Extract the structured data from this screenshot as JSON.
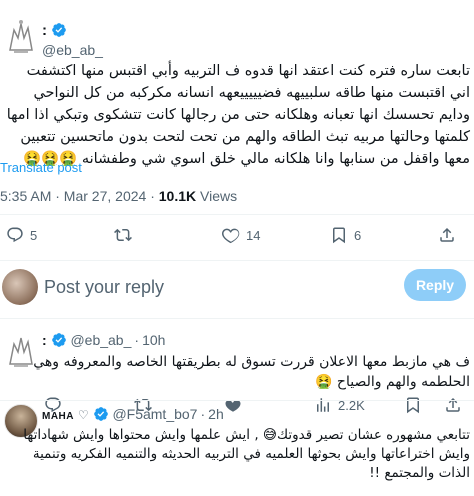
{
  "tweet": {
    "display_name_mark": ":",
    "handle": "@eb_ab_",
    "text": "تابعت ساره فتره كنت اعتقد انها قدوه ف التربيه وأبي اقتبس منها اكتشفت اني اقتبست منها طاقه سلبييهه فضيييييعهه انسانه مكركبه من كل النواحي ودايم تحسسك انها تعبانه وهلكانه حتى من رجالها كانت تتشكوى وتبكي اذا امها كلمتها وحالتها مربيه تبث الطاقه والهم من تحت لتحت بدون ماتحسين تتعبين معها واقفل من سنابها وانا هلكانه مالي خلق اسوي شي وطفشانه 🤮🤮🤮",
    "translate_label": "Translate post",
    "time": "5:35 AM · Mar 27, 2024 · ",
    "views_count": "10.1K",
    "views_label": " Views"
  },
  "actions": {
    "replies": "5",
    "retweets": "",
    "likes": "14",
    "bookmarks": "6"
  },
  "composer": {
    "placeholder": "Post your reply",
    "reply_button": "Reply"
  },
  "comments": [
    {
      "name_mark": ":",
      "handle": "@eb_ab_",
      "time": "10h",
      "text": "ف هي مازبط معها الاعلان قررت تسوق له بطريقتها الخاصه والمعروفه وهي الحلطمه والهم والصياح 🤮",
      "replies": "",
      "retweets": "",
      "likes": "",
      "views": "2.2K"
    },
    {
      "name": "MAHA",
      "handle": "@F5amt_bo7",
      "time": "2h",
      "text": "تتابعي مشهوره عشان تصير قدوتك😅 , ايش علمها وايش محتواها وايش شهاداتها وايش اختراعاتها وايش بحوثها العلميه في التربيه الحديثه والتنميه الفكريه وتنمية الذات والمجتمع !!"
    }
  ],
  "colors": {
    "accent": "#1d9bf0",
    "reply_button_disabled": "#8ecdf8",
    "secondary_text": "#536471"
  }
}
